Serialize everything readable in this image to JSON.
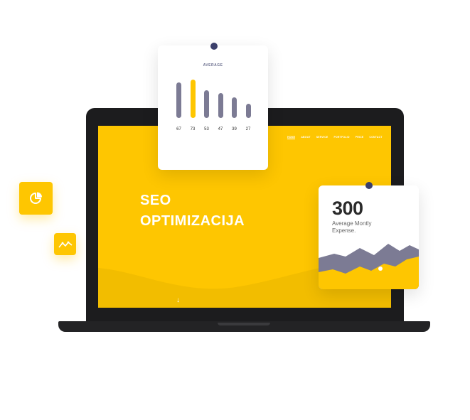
{
  "colors": {
    "accent": "#fec601",
    "bar": "#7c7b94",
    "pin": "#3b3f6b",
    "laptop": "#1c1c1e"
  },
  "site": {
    "nav": [
      "HOME",
      "ABOUT",
      "SERVICE",
      "PORTFOLIO",
      "PRICE",
      "CONTACT"
    ],
    "hero_line1": "SEO",
    "hero_line2": "OPTIMIZACIJA",
    "scroll_icon": "arrow-down-icon"
  },
  "average_card": {
    "title": "AVERAGE",
    "chart_data": {
      "type": "bar",
      "categories": [
        "67",
        "73",
        "53",
        "47",
        "39",
        "27"
      ],
      "values": [
        67,
        73,
        53,
        47,
        39,
        27
      ],
      "highlight_index": 1
    }
  },
  "expense_card": {
    "value": "300",
    "label": "Average Montly Expense."
  },
  "floating_icons": [
    "pie-chart-icon",
    "trend-line-icon"
  ]
}
